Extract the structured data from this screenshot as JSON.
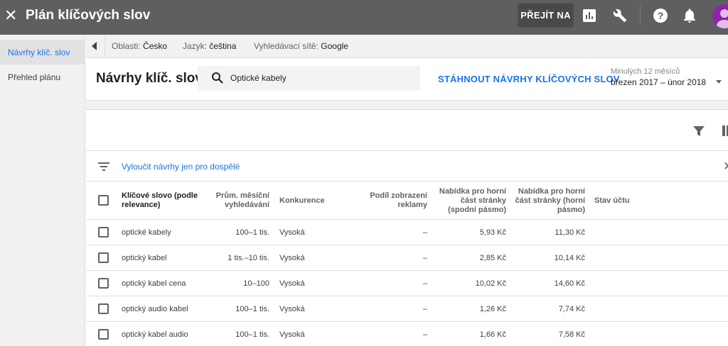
{
  "topbar": {
    "title": "Plán klíčových slov",
    "goto_label": "PŘEJÍT NA",
    "icons": [
      "close-icon",
      "bar-chart-icon",
      "wrench-icon",
      "help-icon",
      "bell-icon",
      "avatar"
    ]
  },
  "sidebar": {
    "items": [
      {
        "label": "Návrhy klíč. slov",
        "active": true
      },
      {
        "label": "Přehled plánu",
        "active": false
      }
    ]
  },
  "filters": [
    {
      "label": "Oblasti:",
      "value": "Česko"
    },
    {
      "label": "Jazyk:",
      "value": "čeština"
    },
    {
      "label": "Vyhledávací sítě:",
      "value": "Google"
    }
  ],
  "header": {
    "page_title": "Návrhy klíč. slov",
    "search_value": "Optické kabely",
    "download_label": "STÁHNOUT NÁVRHY KLÍČOVÝCH SLOV",
    "date_label": "Minulých 12 měsíců",
    "date_value": "březen 2017 – únor 2018"
  },
  "adult_filter": "Vyloučit návrhy jen pro dospělé",
  "table": {
    "headers": {
      "keyword": "Klíčové slovo (podle relevance)",
      "avg_searches": "Prům. měsíční vyhledávání",
      "competition": "Konkurence",
      "impr_share": "Podíl zobrazení reklamy",
      "bid_low": "Nabídka pro horní část stránky (spodní pásmo)",
      "bid_high": "Nabídka pro horní část stránky (horní pásmo)",
      "status": "Stav účtu"
    },
    "rows": [
      {
        "keyword": "optické kabely",
        "avg_searches": "100–1 tis.",
        "competition": "Vysoká",
        "impr_share": "–",
        "bid_low": "5,93 Kč",
        "bid_high": "11,30 Kč"
      },
      {
        "keyword": "optický kabel",
        "avg_searches": "1 tis.–10 tis.",
        "competition": "Vysoká",
        "impr_share": "–",
        "bid_low": "2,85 Kč",
        "bid_high": "10,14 Kč"
      },
      {
        "keyword": "optický kabel cena",
        "avg_searches": "10–100",
        "competition": "Vysoká",
        "impr_share": "–",
        "bid_low": "10,02 Kč",
        "bid_high": "14,60 Kč"
      },
      {
        "keyword": "optický audio kabel",
        "avg_searches": "100–1 tis.",
        "competition": "Vysoká",
        "impr_share": "–",
        "bid_low": "1,26 Kč",
        "bid_high": "7,74 Kč"
      },
      {
        "keyword": "optický kabel audio",
        "avg_searches": "100–1 tis.",
        "competition": "Vysoká",
        "impr_share": "–",
        "bid_low": "1,66 Kč",
        "bid_high": "7,58 Kč"
      }
    ]
  },
  "colors": {
    "topbar": "#5f5f5f",
    "accent": "#1a73e8",
    "sidebar": "#f1f1f1"
  }
}
